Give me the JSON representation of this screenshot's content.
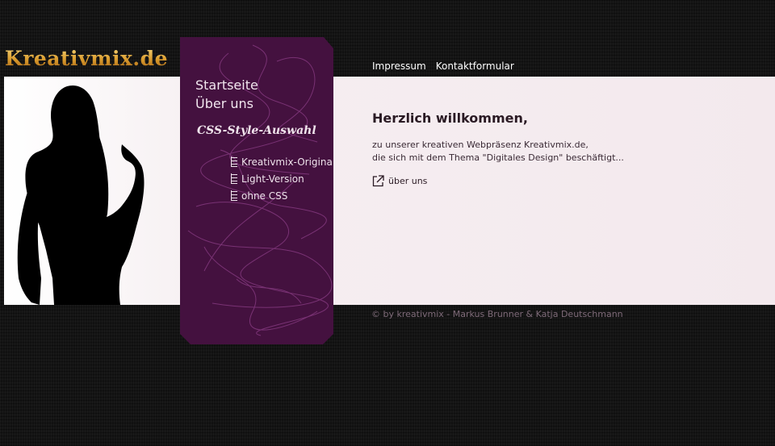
{
  "logo": {
    "text": "Kreativmix.de"
  },
  "topnav": [
    {
      "label": "Impressum"
    },
    {
      "label": "Kontaktformular"
    }
  ],
  "sidebar": {
    "nav": [
      {
        "label": "Startseite"
      },
      {
        "label": "Über uns"
      }
    ],
    "style_title": "CSS-Style-Auswahl",
    "styles": [
      {
        "label": "Kreativmix-Original"
      },
      {
        "label": "Light-Version"
      },
      {
        "label": "ohne CSS"
      }
    ]
  },
  "main": {
    "heading": "Herzlich willkommen,",
    "intro_line1": "zu unserer kreativen Webpräsenz Kreativmix.de,",
    "intro_line2": "die sich mit dem Thema \"Digitales Design\" beschäftigt...",
    "more_link": "über uns"
  },
  "footer": {
    "text": "© by kreativmix - Markus Brunner & Katja Deutschmann"
  },
  "colors": {
    "background": "#141414",
    "sidebar": "#44113f",
    "band": "#f3e9ed",
    "logo_gold": "#d9a43a"
  }
}
